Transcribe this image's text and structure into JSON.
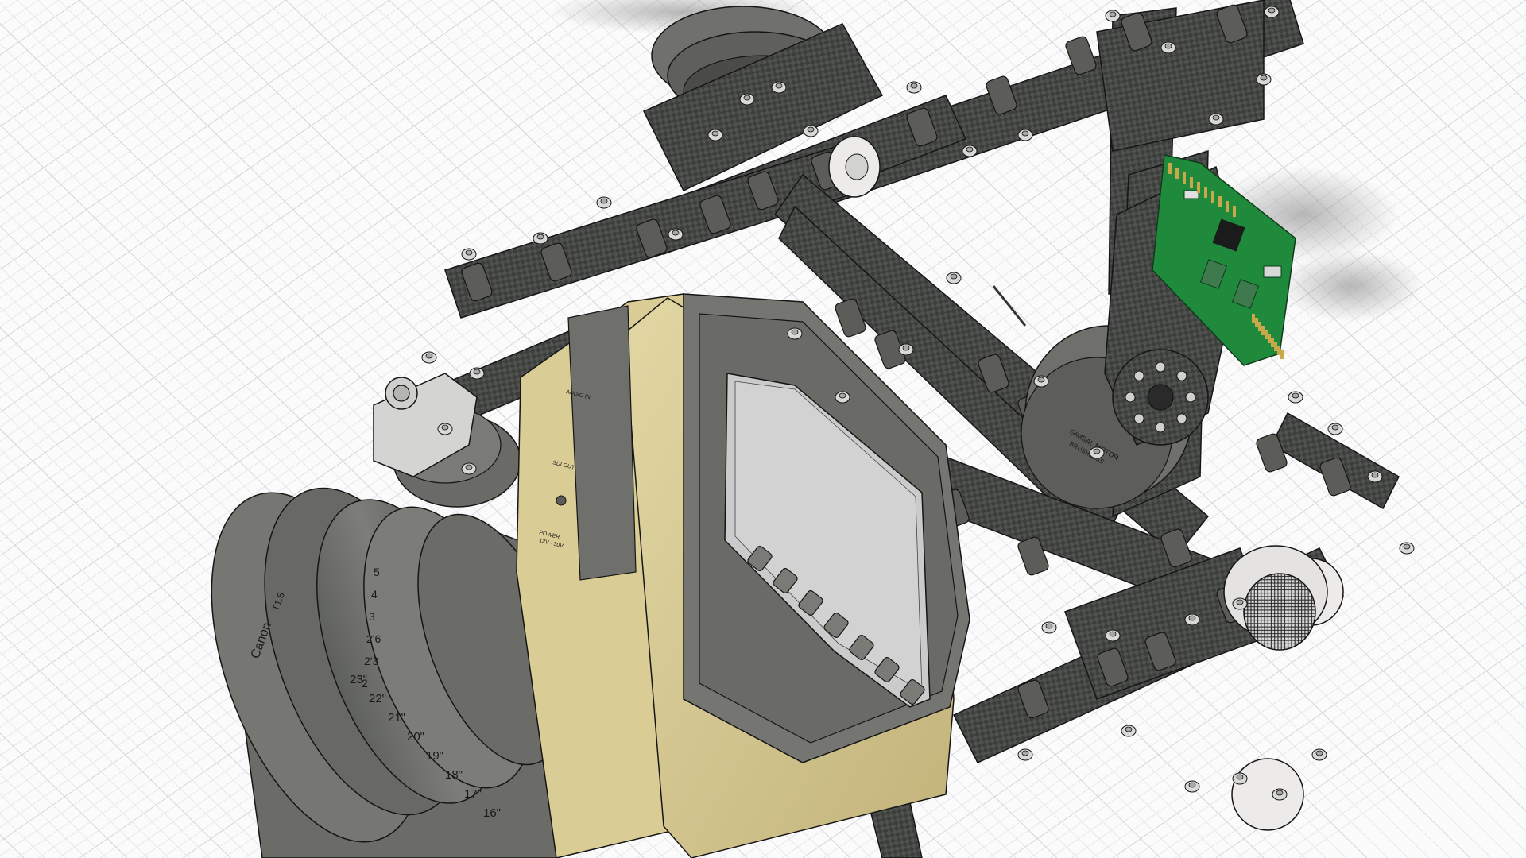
{
  "colors": {
    "background": "#fbfbfb",
    "grid_minor": "#e7e7ec",
    "grid_major": "#d4d4dc",
    "carbon_dark": "#3d3f3d",
    "carbon_mid": "#575957",
    "aluminum": "#6e6f6c",
    "aluminum_light": "#8a8b87",
    "camera_gold": "#cdbf86",
    "camera_gold_dark": "#b5a66c",
    "screen": "#c9c9c9",
    "pcb_green": "#1d8a3a",
    "outline": "#151515",
    "bolt": "#d7d7d7",
    "white_part": "#ecebea"
  },
  "icons": [
    "bolt-icon",
    "camera-button-icon"
  ],
  "camera_panel": {
    "port_audio_in": "AUDIO IN",
    "port_sdi_out": "SDI OUT",
    "port_power": "POWER",
    "port_power_voltage": "12V - 30V"
  },
  "motors": {
    "motor_label_1": "GIMBAL MOTOR",
    "motor_label_2": "BRUSHLESS"
  },
  "lens": {
    "brand": "Canon",
    "marking": "T1.5",
    "distance_scale": [
      "5",
      "4",
      "3",
      "2'6",
      "2'3",
      "2"
    ],
    "inch_scale": [
      "23\"",
      "22\"",
      "21\"",
      "20\"",
      "19\"",
      "18\"",
      "17\"",
      "16\""
    ]
  }
}
